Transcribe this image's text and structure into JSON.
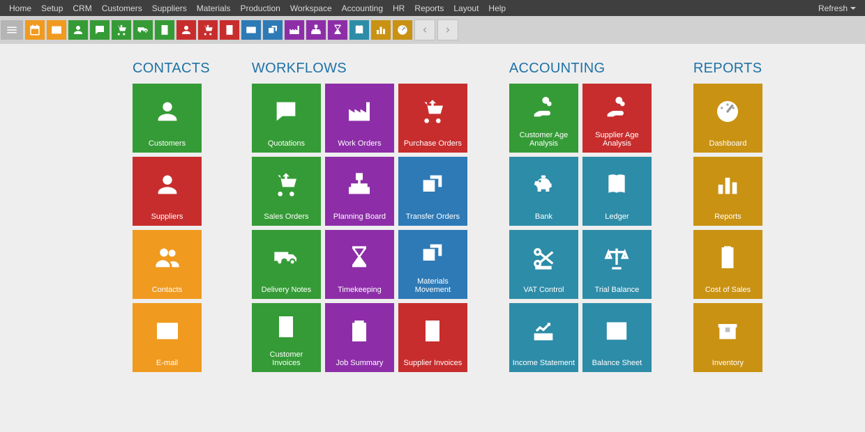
{
  "menubar": {
    "items": [
      "Home",
      "Setup",
      "CRM",
      "Customers",
      "Suppliers",
      "Materials",
      "Production",
      "Workspace",
      "Accounting",
      "HR",
      "Reports",
      "Layout",
      "Help"
    ],
    "refresh": "Refresh"
  },
  "toolbar": {
    "buttons": [
      {
        "name": "menu-hamburger",
        "color": "tool-hamburger",
        "icon": "hamburger"
      },
      {
        "name": "calendar",
        "color": "bg-orange",
        "icon": "calendar"
      },
      {
        "name": "mail",
        "color": "bg-orange",
        "icon": "mail"
      },
      {
        "name": "customers",
        "color": "bg-green",
        "icon": "person"
      },
      {
        "name": "crm-comment",
        "color": "bg-green",
        "icon": "comment"
      },
      {
        "name": "sales-cart",
        "color": "bg-green",
        "icon": "cart"
      },
      {
        "name": "delivery",
        "color": "bg-green",
        "icon": "truck"
      },
      {
        "name": "invoice-doc",
        "color": "bg-green",
        "icon": "doc"
      },
      {
        "name": "suppliers",
        "color": "bg-red",
        "icon": "person"
      },
      {
        "name": "purchase-cart",
        "color": "bg-red",
        "icon": "cart"
      },
      {
        "name": "supplier-invoice-doc",
        "color": "bg-red",
        "icon": "doc"
      },
      {
        "name": "card",
        "color": "bg-blue",
        "icon": "card"
      },
      {
        "name": "cards",
        "color": "bg-blue",
        "icon": "cards"
      },
      {
        "name": "factory",
        "color": "bg-purple",
        "icon": "factory"
      },
      {
        "name": "planning",
        "color": "bg-purple",
        "icon": "tree"
      },
      {
        "name": "timekeeping",
        "color": "bg-purple",
        "icon": "hourglass"
      },
      {
        "name": "ledger",
        "color": "bg-teal",
        "icon": "book"
      },
      {
        "name": "reports-bar",
        "color": "bg-gold",
        "icon": "bars"
      },
      {
        "name": "dashboard-gauge",
        "color": "bg-gold",
        "icon": "gauge"
      }
    ]
  },
  "sections": {
    "contacts": {
      "title": "CONTACTS",
      "tiles": [
        {
          "name": "customers-tile",
          "label": "Customers",
          "color": "c-green",
          "icon": "person"
        },
        {
          "name": "suppliers-tile",
          "label": "Suppliers",
          "color": "c-red",
          "icon": "person"
        },
        {
          "name": "contacts-tile",
          "label": "Contacts",
          "color": "c-orange",
          "icon": "people"
        },
        {
          "name": "email-tile",
          "label": "E-mail",
          "color": "c-orange",
          "icon": "mail"
        }
      ]
    },
    "workflows": {
      "title": "WORKFLOWS",
      "tiles": [
        {
          "name": "quotations-tile",
          "label": "Quotations",
          "color": "c-green",
          "icon": "comment"
        },
        {
          "name": "work-orders-tile",
          "label": "Work Orders",
          "color": "c-purple",
          "icon": "factory"
        },
        {
          "name": "purchase-orders-tile",
          "label": "Purchase Orders",
          "color": "c-red",
          "icon": "cart"
        },
        {
          "name": "sales-orders-tile",
          "label": "Sales Orders",
          "color": "c-green",
          "icon": "cart"
        },
        {
          "name": "planning-board-tile",
          "label": "Planning Board",
          "color": "c-purple",
          "icon": "tree"
        },
        {
          "name": "transfer-orders-tile",
          "label": "Transfer Orders",
          "color": "c-blueD",
          "icon": "transfer"
        },
        {
          "name": "delivery-notes-tile",
          "label": "Delivery Notes",
          "color": "c-green",
          "icon": "truck"
        },
        {
          "name": "timekeeping-tile",
          "label": "Timekeeping",
          "color": "c-purple",
          "icon": "hourglass"
        },
        {
          "name": "materials-movement-tile",
          "label": "Materials Movement",
          "color": "c-blueD",
          "icon": "cards"
        },
        {
          "name": "customer-invoices-tile",
          "label": "Customer Invoices",
          "color": "c-green",
          "icon": "doc"
        },
        {
          "name": "job-summary-tile",
          "label": "Job Summary",
          "color": "c-purple",
          "icon": "clipboard"
        },
        {
          "name": "supplier-invoices-tile",
          "label": "Supplier Invoices",
          "color": "c-red",
          "icon": "doc"
        }
      ]
    },
    "accounting": {
      "title": "ACCOUNTING",
      "tiles": [
        {
          "name": "customer-age-tile",
          "label": "Customer Age Analysis",
          "color": "c-green",
          "icon": "hand"
        },
        {
          "name": "supplier-age-tile",
          "label": "Supplier Age Analysis",
          "color": "c-red",
          "icon": "hand"
        },
        {
          "name": "bank-tile",
          "label": "Bank",
          "color": "c-teal",
          "icon": "piggy"
        },
        {
          "name": "ledger-tile",
          "label": "Ledger",
          "color": "c-teal",
          "icon": "book"
        },
        {
          "name": "vat-control-tile",
          "label": "VAT Control",
          "color": "c-teal",
          "icon": "scissors"
        },
        {
          "name": "trial-balance-tile",
          "label": "Trial Balance",
          "color": "c-teal",
          "icon": "scale"
        },
        {
          "name": "income-statement-tile",
          "label": "Income Statement",
          "color": "c-teal",
          "icon": "income"
        },
        {
          "name": "balance-sheet-tile",
          "label": "Balance Sheet",
          "color": "c-teal",
          "icon": "sheet"
        }
      ]
    },
    "reports": {
      "title": "REPORTS",
      "tiles": [
        {
          "name": "dashboard-tile",
          "label": "Dashboard",
          "color": "c-gold",
          "icon": "gauge"
        },
        {
          "name": "reports-tile",
          "label": "Reports",
          "color": "c-gold",
          "icon": "bars"
        },
        {
          "name": "cost-of-sales-tile",
          "label": "Cost of Sales",
          "color": "c-gold",
          "icon": "checklist"
        },
        {
          "name": "inventory-tile",
          "label": "Inventory",
          "color": "c-gold",
          "icon": "box"
        }
      ]
    }
  }
}
